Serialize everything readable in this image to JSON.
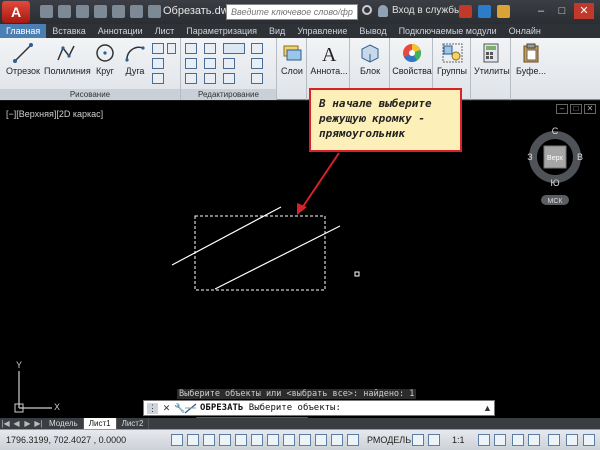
{
  "titlebar": {
    "app_logo": "A",
    "doc_title": "Обрезать.dwg",
    "search_placeholder": "Введите ключевое слово/фразу",
    "login_label": "Вход в службы"
  },
  "ribbon_tabs": [
    "Главная",
    "Вставка",
    "Аннотации",
    "Лист",
    "Параметризация",
    "Вид",
    "Управление",
    "Вывод",
    "Подключаемые модули",
    "Онлайн"
  ],
  "ribbon": {
    "draw_panel_title": "Рисование",
    "modify_panel_title": "Редактирование",
    "tools": {
      "line": "Отрезок",
      "polyline": "Полилиния",
      "circle": "Круг",
      "arc": "Дуга",
      "layers": "Слои",
      "annotation": "Аннота...",
      "block": "Блок",
      "properties": "Свойства",
      "groups": "Группы",
      "utilities": "Утилиты",
      "clipboard": "Буфе..."
    }
  },
  "viewport": {
    "label": "[−][Верхняя][2D каркас]",
    "viewcube": {
      "north": "С",
      "south": "Ю",
      "west": "З",
      "east": "В",
      "face": "Верх",
      "ucs": "МСК"
    },
    "ucs_icon": {
      "x": "X",
      "y": "Y"
    }
  },
  "callout": {
    "text": "В начале выберите режущую кромку - прямоугольник"
  },
  "command": {
    "history": "Выберите объекты или <выбрать все>: найдено: 1",
    "command_name": "ОБРЕЗАТЬ",
    "prompt": "Выберите объекты:"
  },
  "layout_tabs": [
    "Модель",
    "Лист1",
    "Лист2"
  ],
  "statusbar": {
    "coordinates": "1796.3199, 702.4027 , 0.0000",
    "model_label": "РМОДЕЛЬ",
    "scale_label": "1:1"
  },
  "colors": {
    "accent": "#4b7fb4",
    "callout_border": "#d8222a",
    "callout_fill": "#fcf0b8",
    "drawing_bg": "#000000",
    "geometry": "#ffffff"
  }
}
